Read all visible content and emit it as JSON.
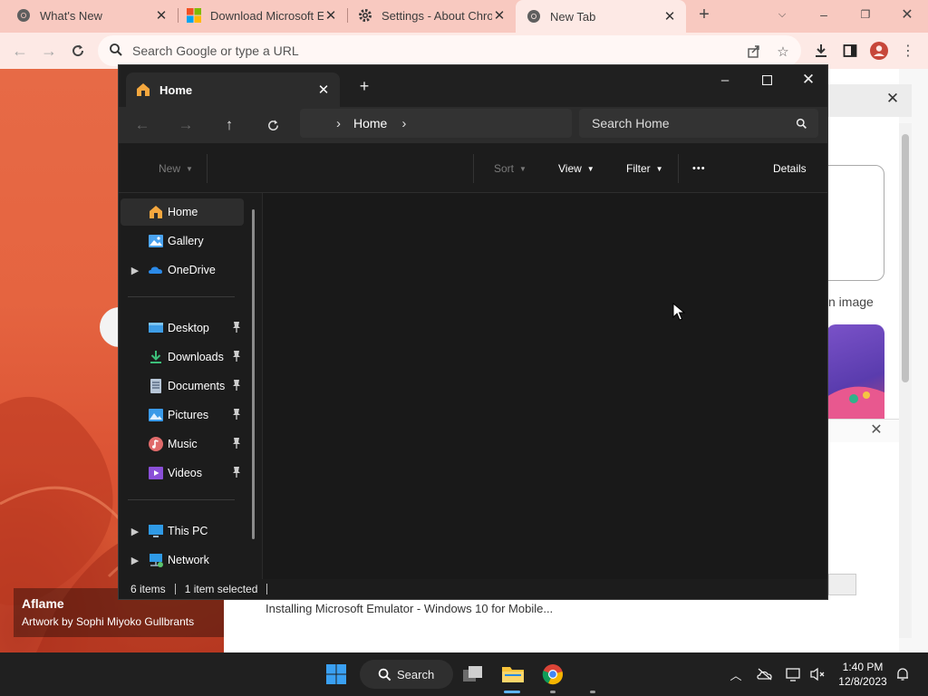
{
  "chrome": {
    "tabs": [
      {
        "label": "What's New",
        "icon": "chrome-logo-icon"
      },
      {
        "label": "Download Microsoft E",
        "icon": "microsoft-logo-icon"
      },
      {
        "label": "Settings - About Chro",
        "icon": "gear-icon"
      },
      {
        "label": "New Tab",
        "icon": "chrome-logo-icon",
        "active": true
      }
    ],
    "omnibox_placeholder": "Search Google or type a URL",
    "accent": "#f8c9c0"
  },
  "ntp": {
    "attribution_title": "Aflame",
    "attribution_sub": "Artwork by Sophi Miyoko Gullbrants",
    "search_image_label": "n image",
    "footer_text": "Installing Microsoft Emulator - Windows 10 for Mobile..."
  },
  "explorer": {
    "tab_label": "Home",
    "address": "Home",
    "search_placeholder": "Search Home",
    "commands": {
      "new": "New",
      "sort": "Sort",
      "view": "View",
      "filter": "Filter",
      "more": "•••",
      "details": "Details"
    },
    "nav": {
      "home": "Home",
      "gallery": "Gallery",
      "onedrive": "OneDrive",
      "desktop": "Desktop",
      "downloads": "Downloads",
      "documents": "Documents",
      "pictures": "Pictures",
      "music": "Music",
      "videos": "Videos",
      "this_pc": "This PC",
      "network": "Network"
    },
    "status": {
      "items": "6 items",
      "selected": "1 item selected"
    }
  },
  "taskbar": {
    "search_label": "Search",
    "time": "1:40 PM",
    "date": "12/8/2023"
  }
}
